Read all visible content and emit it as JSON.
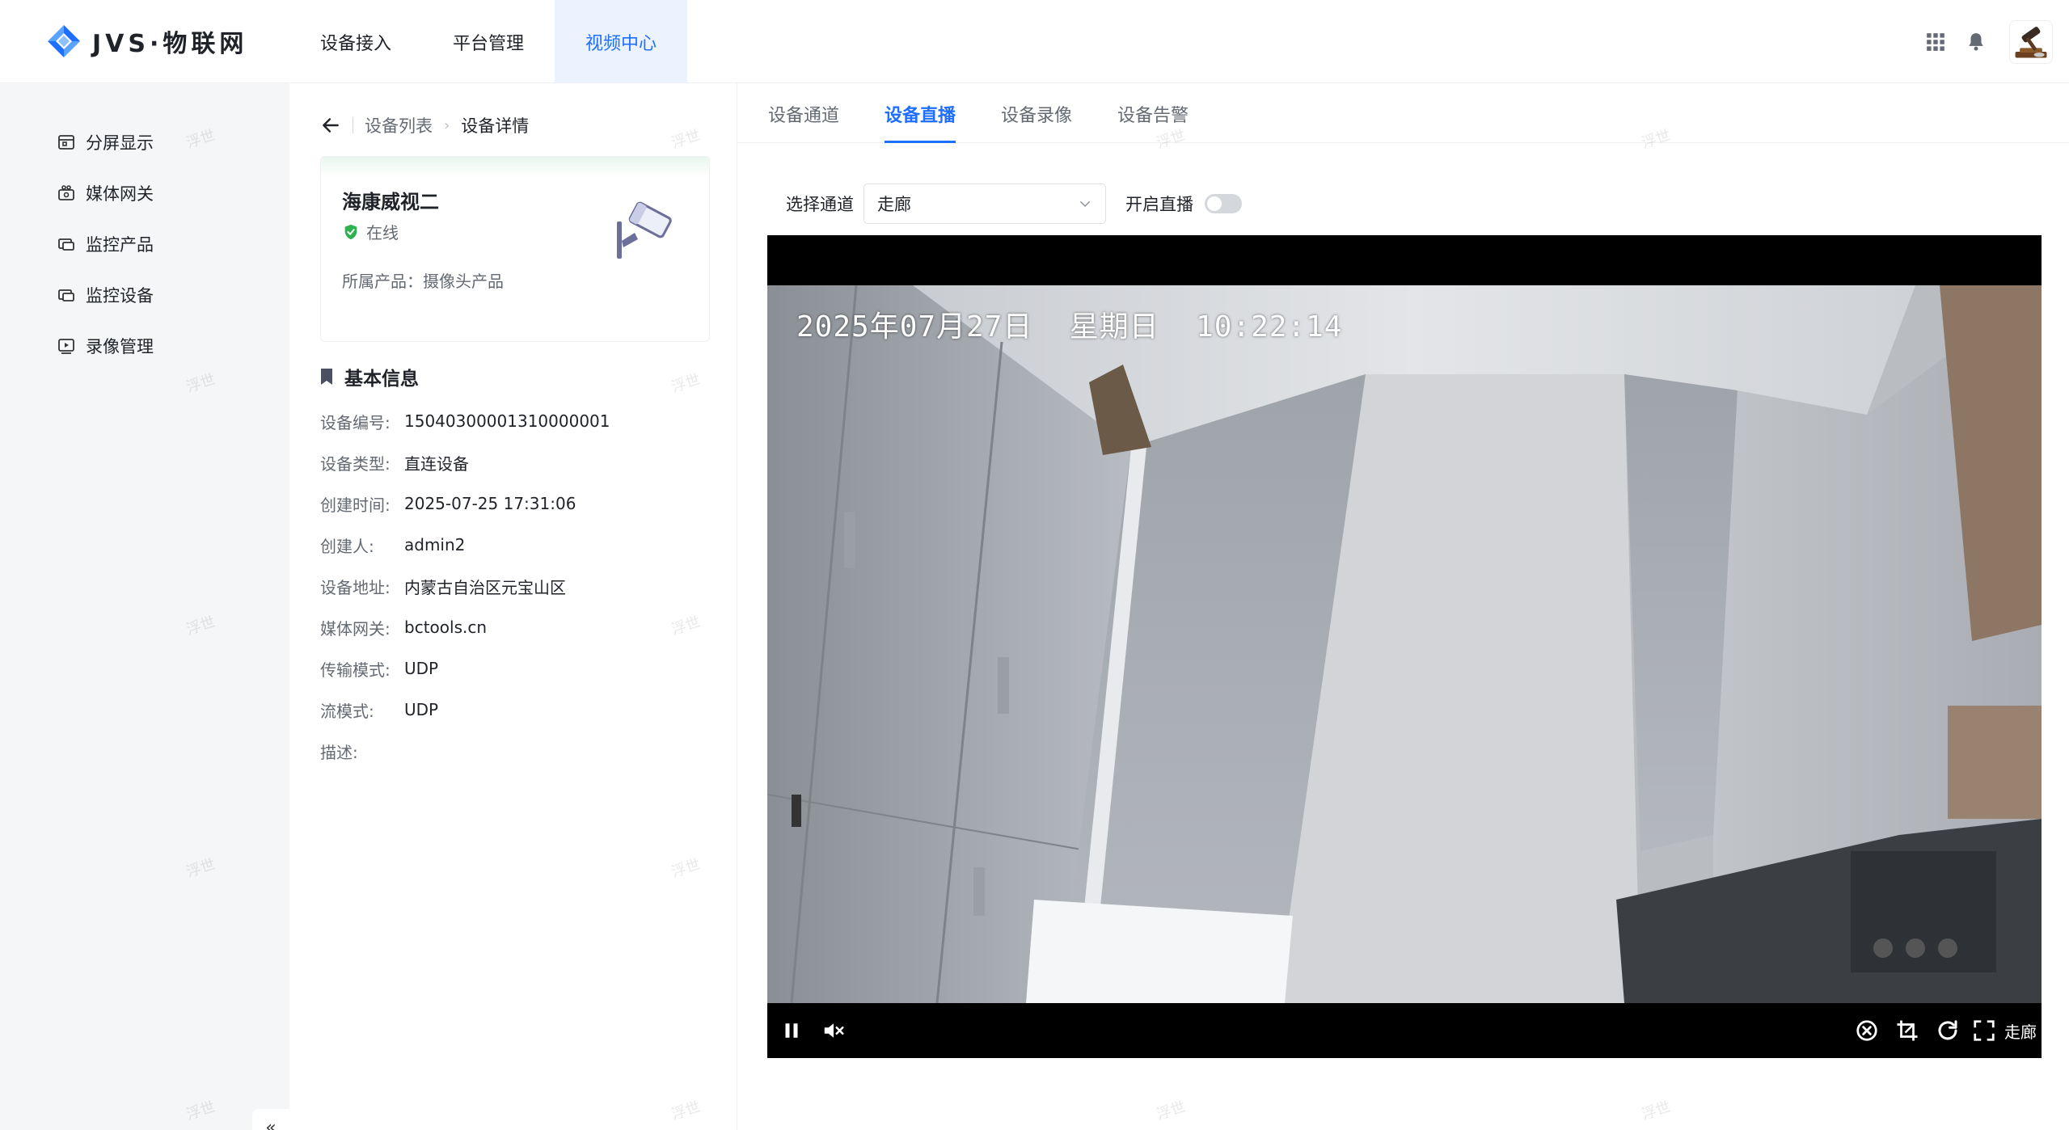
{
  "app": {
    "logo_text": "JVS·物联网",
    "brand_color": "#1e6fff"
  },
  "nav": {
    "items": [
      {
        "label": "设备接入"
      },
      {
        "label": "平台管理"
      },
      {
        "label": "视频中心"
      }
    ],
    "active_index": 2
  },
  "header_icons": [
    "apps-grid-icon",
    "bell-icon",
    "avatar"
  ],
  "sidebar": {
    "items": [
      {
        "label": "分屏显示",
        "icon": "split-screen-icon"
      },
      {
        "label": "媒体网关",
        "icon": "gateway-icon"
      },
      {
        "label": "监控产品",
        "icon": "monitor-product-icon"
      },
      {
        "label": "监控设备",
        "icon": "monitor-device-icon"
      },
      {
        "label": "录像管理",
        "icon": "recording-icon"
      }
    ],
    "collapse_glyph": "«"
  },
  "breadcrumb": {
    "parent": "设备列表",
    "current": "设备详情"
  },
  "device": {
    "name": "海康威视二",
    "status": "在线",
    "status_color": "#2fb152",
    "product": "所属产品：摄像头产品"
  },
  "basic_info": {
    "title": "基本信息",
    "rows": [
      {
        "key": "设备编号:",
        "value": "15040300001310000001"
      },
      {
        "key": "设备类型:",
        "value": "直连设备"
      },
      {
        "key": "创建时间:",
        "value": "2025-07-25 17:31:06"
      },
      {
        "key": "创建人:",
        "value": "admin2"
      },
      {
        "key": "设备地址:",
        "value": "内蒙古自治区元宝山区"
      },
      {
        "key": "媒体网关:",
        "value": "bctools.cn"
      },
      {
        "key": "传输模式:",
        "value": "UDP"
      },
      {
        "key": "流模式:",
        "value": "UDP"
      },
      {
        "key": "描述:",
        "value": ""
      }
    ]
  },
  "tabs": {
    "items": [
      {
        "label": "设备通道"
      },
      {
        "label": "设备直播"
      },
      {
        "label": "设备录像"
      },
      {
        "label": "设备告警"
      }
    ],
    "active_index": 1
  },
  "channel": {
    "label": "选择通道",
    "selected": "走廊",
    "live_label": "开启直播",
    "live_on": false
  },
  "player": {
    "osd_text": "2025年07月27日  星期日  10:22:14",
    "channel_name": "走廊",
    "paused": false,
    "muted": true
  },
  "watermark_text": "浮世"
}
